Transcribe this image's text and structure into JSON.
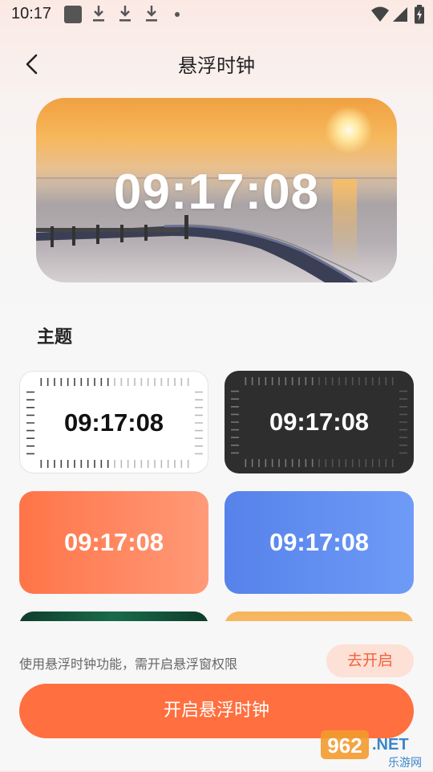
{
  "status_bar": {
    "time": "10:17",
    "icons": [
      "notification-square-icon",
      "download-icon",
      "download-icon",
      "download-icon",
      "dot-icon",
      "wifi-icon",
      "signal-icon",
      "battery-charging-icon"
    ]
  },
  "header": {
    "back_icon": "chevron-left-icon",
    "title": "悬浮时钟"
  },
  "hero": {
    "clock": "09:17:08",
    "background": "sunset-sea-bridge"
  },
  "themes_section": {
    "title": "主题",
    "themes": [
      {
        "name": "white-ticks",
        "clock": "09:17:08"
      },
      {
        "name": "dark-ticks",
        "clock": "09:17:08"
      },
      {
        "name": "orange",
        "clock": "09:17:08"
      },
      {
        "name": "blue",
        "clock": "09:17:08"
      },
      {
        "name": "green-forest",
        "clock": ""
      },
      {
        "name": "sunset",
        "clock": ""
      }
    ]
  },
  "permission": {
    "text": "使用悬浮时钟功能，需开启悬浮窗权限",
    "button": "去开启"
  },
  "main_button": "开启悬浮时钟",
  "watermark": {
    "number": "962",
    "suffix": ".NET",
    "text": "乐游网"
  },
  "colors": {
    "accent": "#ff6f3f",
    "accent_light": "#fde0d6",
    "orange_theme": "#ff7448",
    "blue_theme": "#5682ea",
    "dark_theme": "#2e2e2e"
  }
}
